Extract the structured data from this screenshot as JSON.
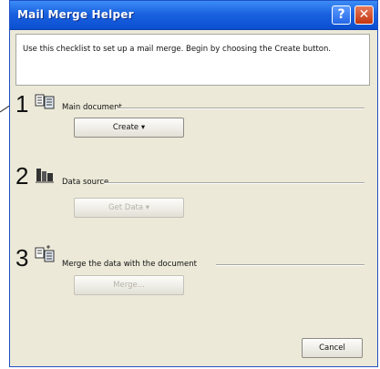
{
  "window": {
    "title": "Mail Merge Helper",
    "help_glyph": "?",
    "close_glyph": "✕"
  },
  "intro": {
    "text": "Use this checklist to set up a mail merge. Begin by choosing the Create button."
  },
  "steps": [
    {
      "number": "1",
      "icon": "main-document-icon",
      "label": "Main document",
      "button": "Create ▾",
      "button_enabled": true
    },
    {
      "number": "2",
      "icon": "data-source-icon",
      "label": "Data source",
      "button": "Get Data ▾",
      "button_enabled": false
    },
    {
      "number": "3",
      "icon": "merge-icon",
      "label": "Merge the data with the document",
      "button": "Merge...",
      "button_enabled": false
    }
  ],
  "footer": {
    "cancel_label": "Cancel"
  },
  "colors": {
    "titlebar": "#1b62e0",
    "dialog_bg": "#ece9d8",
    "close_button": "#c2350f"
  }
}
